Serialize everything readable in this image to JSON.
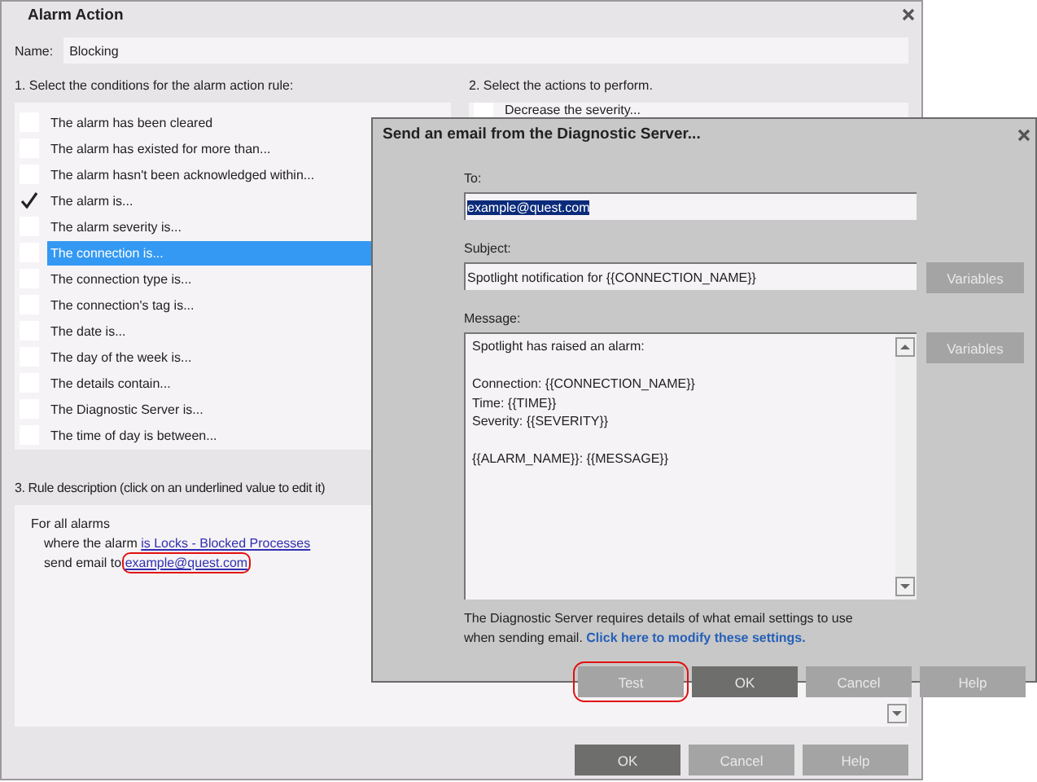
{
  "main_window": {
    "title": "Alarm Action",
    "name_label": "Name:",
    "name_value": "Blocking",
    "conditions_label": "1. Select the conditions for the alarm action rule:",
    "conditions": [
      {
        "label": "The alarm has been cleared",
        "checked": false,
        "selected": false
      },
      {
        "label": "The alarm has existed for more than...",
        "checked": false,
        "selected": false
      },
      {
        "label": "The alarm hasn't been acknowledged within...",
        "checked": false,
        "selected": false
      },
      {
        "label": "The alarm is...",
        "checked": true,
        "selected": false
      },
      {
        "label": "The alarm severity is...",
        "checked": false,
        "selected": false
      },
      {
        "label": "The connection is...",
        "checked": false,
        "selected": true
      },
      {
        "label": "The connection type is...",
        "checked": false,
        "selected": false
      },
      {
        "label": "The connection's tag is...",
        "checked": false,
        "selected": false
      },
      {
        "label": "The date is...",
        "checked": false,
        "selected": false
      },
      {
        "label": "The day of the week is...",
        "checked": false,
        "selected": false
      },
      {
        "label": "The details contain...",
        "checked": false,
        "selected": false
      },
      {
        "label": "The Diagnostic Server is...",
        "checked": false,
        "selected": false
      },
      {
        "label": "The time of day is between...",
        "checked": false,
        "selected": false
      }
    ],
    "actions_label": "2. Select the actions to perform.",
    "actions": [
      {
        "label": "Decrease the severity...",
        "checked": false
      }
    ],
    "description_label": "3. Rule description (click on an underlined value to edit it)",
    "description_lines": [
      {
        "text": "For all alarms"
      },
      {
        "text": "where the alarm ",
        "link": "is Locks - Blocked Processes",
        "highlighted": false
      },
      {
        "text": "send email to ",
        "link": "example@quest.com",
        "highlighted": true
      }
    ],
    "buttons": [
      {
        "label": "OK",
        "default": true
      },
      {
        "label": "Cancel",
        "default": false
      },
      {
        "label": "Help",
        "default": false
      }
    ]
  },
  "email_dialog": {
    "title": "Send an email from the Diagnostic Server...",
    "to_label": "To:",
    "to_value": "example@quest.com",
    "to_value_selected": true,
    "subject_label": "Subject:",
    "subject_value": "Spotlight notification for {{CONNECTION_NAME}}",
    "subject_button": "Variables",
    "message_label": "Message:",
    "message_value": "Spotlight has raised an alarm:\n\nConnection: {{CONNECTION_NAME}}\nTime: {{TIME}}\nSeverity: {{SEVERITY}}\n\n{{ALARM_NAME}}: {{MESSAGE}}",
    "message_button": "Variables",
    "note": "The Diagnostic Server requires details of what email settings to use when sending email.",
    "note_link": "Click here to modify these settings.",
    "buttons": [
      {
        "label": "Test",
        "default": false,
        "highlighted": true
      },
      {
        "label": "OK",
        "default": true,
        "highlighted": false
      },
      {
        "label": "Cancel",
        "default": false,
        "highlighted": false
      },
      {
        "label": "Help",
        "default": false,
        "highlighted": false
      }
    ]
  }
}
